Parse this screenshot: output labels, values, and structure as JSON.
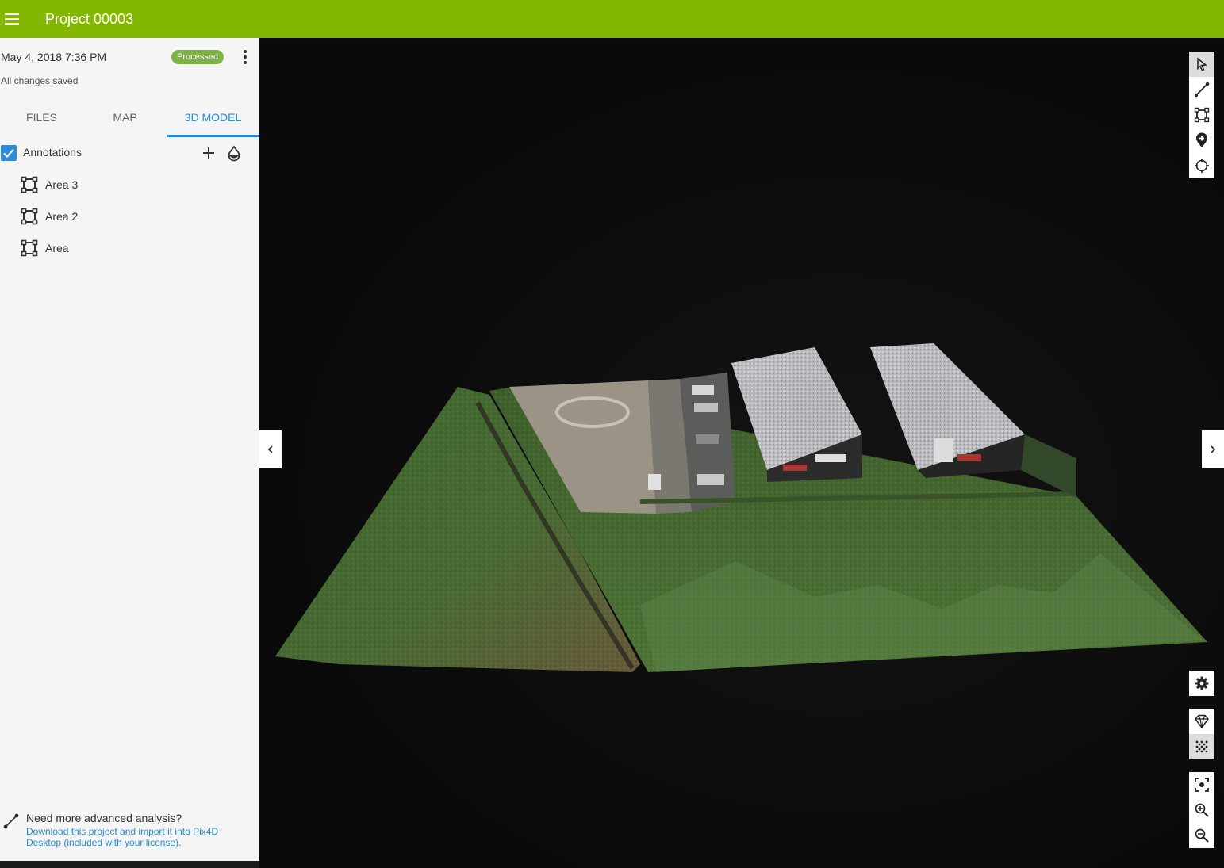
{
  "header": {
    "title": "Project 00003",
    "menu_icon": "hamburger-menu-icon",
    "color": "#84b800"
  },
  "project": {
    "date": "May 4, 2018 7:36 PM",
    "status": "Processed",
    "status_color": "#7cb342",
    "save_state": "All changes saved"
  },
  "tabs": [
    {
      "label": "FILES",
      "active": false
    },
    {
      "label": "MAP",
      "active": false
    },
    {
      "label": "3D MODEL",
      "active": true
    }
  ],
  "annotations": {
    "title": "Annotations",
    "checked": true,
    "items": [
      {
        "label": "Area 3",
        "icon": "area-polygon-icon"
      },
      {
        "label": "Area 2",
        "icon": "area-polygon-icon"
      },
      {
        "label": "Area",
        "icon": "area-polygon-icon"
      }
    ]
  },
  "footer": {
    "question": "Need more advanced analysis?",
    "link": "Download this project and import it into Pix4D Desktop (included with your license)."
  },
  "viewer": {
    "tools_top": [
      "select-pointer-icon",
      "measure-line-icon",
      "measure-area-icon",
      "add-marker-icon",
      "crosshair-icon"
    ],
    "tools_bottom": [
      "settings-gear-icon",
      "mesh-render-icon",
      "point-cloud-icon",
      "focus-icon",
      "zoom-in-icon",
      "zoom-out-icon"
    ],
    "accent": "#2a8be0"
  }
}
